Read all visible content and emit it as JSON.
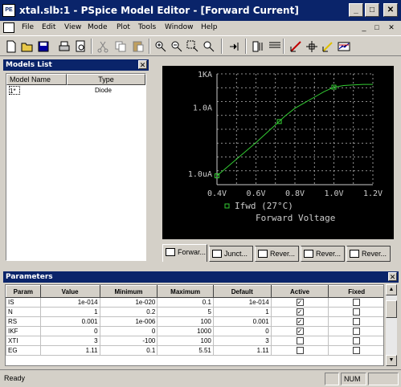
{
  "window": {
    "title": "xtal.slb:1 - PSpice Model Editor - [Forward Current]",
    "icon_text": "PE",
    "controls": [
      "_",
      "□",
      "✕"
    ]
  },
  "menu": {
    "items": [
      "File",
      "Edit",
      "View",
      "Mode",
      "Plot",
      "Tools",
      "Window",
      "Help"
    ],
    "mdi_controls": [
      "_",
      "□",
      "✕"
    ]
  },
  "toolbar": {
    "icons": [
      "new-icon",
      "open-icon",
      "save-icon",
      "print-icon",
      "print-preview-icon",
      "cut-icon",
      "copy-icon",
      "paste-icon",
      "zoom-in-icon",
      "zoom-out-icon",
      "zoom-area-icon",
      "zoom-fit-icon",
      "extract-icon",
      "layout-icon",
      "grid-icon",
      "edit-point-icon",
      "cursor-icon",
      "trace-icon",
      "graph-icon"
    ]
  },
  "models_list": {
    "title": "Models List",
    "columns": [
      "Model Name",
      "Type"
    ],
    "rows": [
      {
        "name": "1*",
        "type": "Diode"
      }
    ]
  },
  "chart_data": {
    "type": "line",
    "scale": "log-y",
    "x_ticks": [
      "0.4V",
      "0.6V",
      "0.8V",
      "1.0V",
      "1.2V"
    ],
    "y_ticks": [
      "1KA",
      "1.0A",
      "1.0uA"
    ],
    "xlim": [
      0.4,
      1.2
    ],
    "ylim_log10": [
      -7,
      3
    ],
    "grid": true,
    "series": [
      {
        "name": "Ifwd (27°C)",
        "x": [
          0.4,
          0.5,
          0.6,
          0.7,
          0.75,
          0.8,
          0.9,
          0.95,
          1.0,
          1.05,
          1.1,
          1.15,
          1.2
        ],
        "y_log10": [
          -6.2,
          -4.7,
          -3.2,
          -1.6,
          -0.8,
          -0.1,
          0.9,
          1.4,
          1.8,
          1.95,
          2.0,
          2.05,
          2.05
        ],
        "points_x": [
          0.4,
          0.72,
          1.0
        ],
        "points_y_log10": [
          -6.2,
          -1.3,
          1.8
        ]
      }
    ],
    "legend": "Ifwd (27°C)",
    "xlabel": "Forward Voltage",
    "color": "#33cc33"
  },
  "tabs": [
    "Forwar...",
    "Junct...",
    "Rever...",
    "Rever...",
    "Rever..."
  ],
  "parameters": {
    "title": "Parameters",
    "columns": [
      "Param",
      "Value",
      "Minimum",
      "Maximum",
      "Default",
      "Active",
      "Fixed"
    ],
    "rows": [
      {
        "param": "IS",
        "value": "1e-014",
        "min": "1e-020",
        "max": "0.1",
        "default": "1e-014",
        "active": true,
        "fixed": false
      },
      {
        "param": "N",
        "value": "1",
        "min": "0.2",
        "max": "5",
        "default": "1",
        "active": true,
        "fixed": false
      },
      {
        "param": "RS",
        "value": "0.001",
        "min": "1e-006",
        "max": "100",
        "default": "0.001",
        "active": true,
        "fixed": false
      },
      {
        "param": "IKF",
        "value": "0",
        "min": "0",
        "max": "1000",
        "default": "0",
        "active": true,
        "fixed": false
      },
      {
        "param": "XTI",
        "value": "3",
        "min": "-100",
        "max": "100",
        "default": "3",
        "active": false,
        "fixed": false
      },
      {
        "param": "EG",
        "value": "1.11",
        "min": "0.1",
        "max": "5.51",
        "default": "1.11",
        "active": false,
        "fixed": false
      }
    ]
  },
  "status": {
    "text": "Ready",
    "num": "NUM"
  }
}
